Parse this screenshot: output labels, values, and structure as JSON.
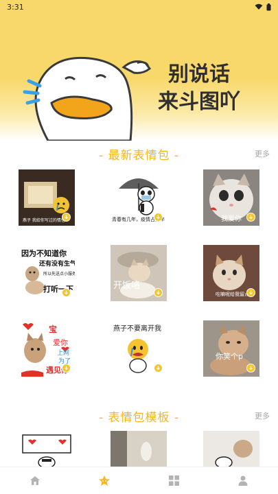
{
  "status_bar": {
    "time": "3:31"
  },
  "hero": {
    "line1": "别说话",
    "line2": "来斗图吖"
  },
  "sections": {
    "latest": {
      "title": "- 最新表情包 -",
      "more": "更多"
    },
    "templates": {
      "title": "- 表情包模板 -",
      "more": "更多"
    }
  },
  "latest_items": [
    {
      "caption": "燕子 我给你写过的情信",
      "caption_color": "#ffffff"
    },
    {
      "caption": "青春有几年，疫情占三年",
      "caption_color": "#222222"
    },
    {
      "caption": "我爱你",
      "caption_color": "#ffffff"
    },
    {
      "caption_top": "因为不知道你",
      "caption_mid": "还有没有生气",
      "caption_small": "所以先送点小服务",
      "caption_bottom": "打听一下",
      "caption_color": "#111111"
    },
    {
      "caption": "开饭咯",
      "caption_color": "#ffffff"
    },
    {
      "caption": "吃嘛呢给我留点",
      "caption_color": "#ffffff"
    },
    {
      "w1": "宝",
      "w2": "爱你",
      "w3": "上网",
      "w4": "为了",
      "w5": "遇见你",
      "caption_color": "#e0322b"
    },
    {
      "caption": "燕子不要离开我",
      "caption_color": "#222222"
    },
    {
      "caption": "你笑个p",
      "caption_color": "#ffffff"
    }
  ],
  "bottom_nav": [
    {
      "icon": "home-icon",
      "active": false
    },
    {
      "icon": "star-icon",
      "active": true
    },
    {
      "icon": "grid-icon",
      "active": false
    },
    {
      "icon": "user-icon",
      "active": false
    }
  ],
  "colors": {
    "accent": "#f6b61c",
    "hero_yellow": "#f8d86a",
    "inactive": "#b3b3b3"
  }
}
